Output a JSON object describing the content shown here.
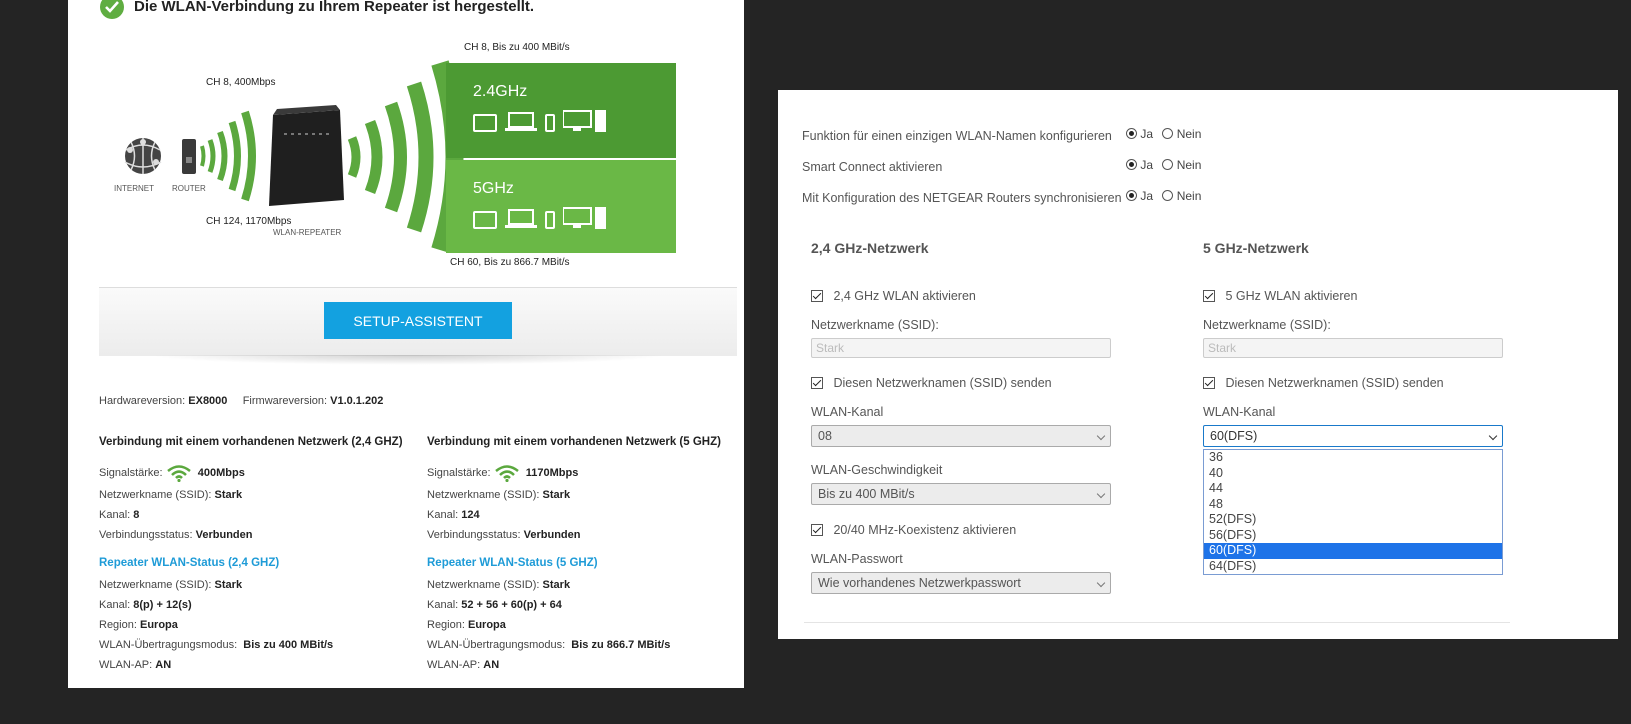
{
  "left": {
    "success_message": "Die WLAN-Verbindung zu Ihrem Repeater ist hergestellt.",
    "diagram": {
      "internet_label": "INTERNET",
      "router_label": "ROUTER",
      "repeater_label": "WLAN-REPEATER",
      "link24_label": "CH 8, 400Mbps",
      "link5_label": "CH 124, 1170Mbps",
      "out24_label": "CH 8, Bis zu 400 MBit/s",
      "out5_label": "CH 60, Bis zu 866.7 MBit/s",
      "band24": "2.4GHz",
      "band5": "5GHz"
    },
    "setup_button": "SETUP-ASSISTENT",
    "hw_label": "Hardwareversion:",
    "hw_value": "EX8000",
    "fw_label": "Firmwareversion:",
    "fw_value": "V1.0.1.202",
    "col24": {
      "title": "Verbindung mit einem vorhandenen Netzwerk (2,4 GHZ)",
      "signal_label": "Signalstärke:",
      "signal_value": "400Mbps",
      "ssid_label": "Netzwerkname (SSID):",
      "ssid_value": "Stark",
      "kanal_label": "Kanal:",
      "kanal_value": "8",
      "status_label": "Verbindungsstatus:",
      "status_value": "Verbunden",
      "rep_title": "Repeater WLAN-Status (2,4 GHZ)",
      "rep_ssid_label": "Netzwerkname (SSID):",
      "rep_ssid_value": "Stark",
      "rep_kanal_label": "Kanal:",
      "rep_kanal_value": "8(p) + 12(s)",
      "region_label": "Region:",
      "region_value": "Europa",
      "mode_label": "WLAN-Übertragungsmodus:",
      "mode_value": "Bis zu 400 MBit/s",
      "ap_label": "WLAN-AP:",
      "ap_value": "AN"
    },
    "col5": {
      "title": "Verbindung mit einem vorhandenen Netzwerk (5 GHZ)",
      "signal_label": "Signalstärke:",
      "signal_value": "1170Mbps",
      "ssid_label": "Netzwerkname (SSID):",
      "ssid_value": "Stark",
      "kanal_label": "Kanal:",
      "kanal_value": "124",
      "status_label": "Verbindungsstatus:",
      "status_value": "Verbunden",
      "rep_title": "Repeater WLAN-Status (5 GHZ)",
      "rep_ssid_label": "Netzwerkname (SSID):",
      "rep_ssid_value": "Stark",
      "rep_kanal_label": "Kanal:",
      "rep_kanal_value": "52 + 56 + 60(p) + 64",
      "region_label": "Region:",
      "region_value": "Europa",
      "mode_label": "WLAN-Übertragungsmodus:",
      "mode_value": "Bis zu 866.7 MBit/s",
      "ap_label": "WLAN-AP:",
      "ap_value": "AN"
    }
  },
  "right": {
    "opt_single_name": "Funktion für einen einzigen WLAN-Namen konfigurieren",
    "opt_smart_connect": "Smart Connect aktivieren",
    "opt_sync": "Mit Konfiguration des NETGEAR Routers synchronisieren",
    "ja": "Ja",
    "nein": "Nein",
    "net24": {
      "header": "2,4 GHz-Netzwerk",
      "enable_label": "2,4 GHz WLAN aktivieren",
      "ssid_label": "Netzwerkname (SSID):",
      "ssid_value": "Stark",
      "broadcast_label": "Diesen Netzwerknamen (SSID) senden",
      "kanal_label": "WLAN-Kanal",
      "kanal_value": "08",
      "speed_label": "WLAN-Geschwindigkeit",
      "speed_value": "Bis zu 400 MBit/s",
      "coexist_label": "20/40 MHz-Koexistenz aktivieren",
      "pw_label": "WLAN-Passwort",
      "pw_value": "Wie vorhandenes Netzwerkpasswort"
    },
    "net5": {
      "header": "5 GHz-Netzwerk",
      "enable_label": "5 GHz WLAN aktivieren",
      "ssid_label": "Netzwerkname (SSID):",
      "ssid_value": "Stark",
      "broadcast_label": "Diesen Netzwerknamen (SSID) senden",
      "kanal_label": "WLAN-Kanal",
      "kanal_value": "60(DFS)",
      "kanal_options": [
        "36",
        "40",
        "44",
        "48",
        "52(DFS)",
        "56(DFS)",
        "60(DFS)",
        "64(DFS)"
      ]
    }
  },
  "colors": {
    "green_dark": "#4c9a33",
    "green_light": "#6ab846",
    "button_blue": "#13a1e0",
    "link_blue": "#1e9bd7",
    "select_highlight": "#1e73e8"
  }
}
